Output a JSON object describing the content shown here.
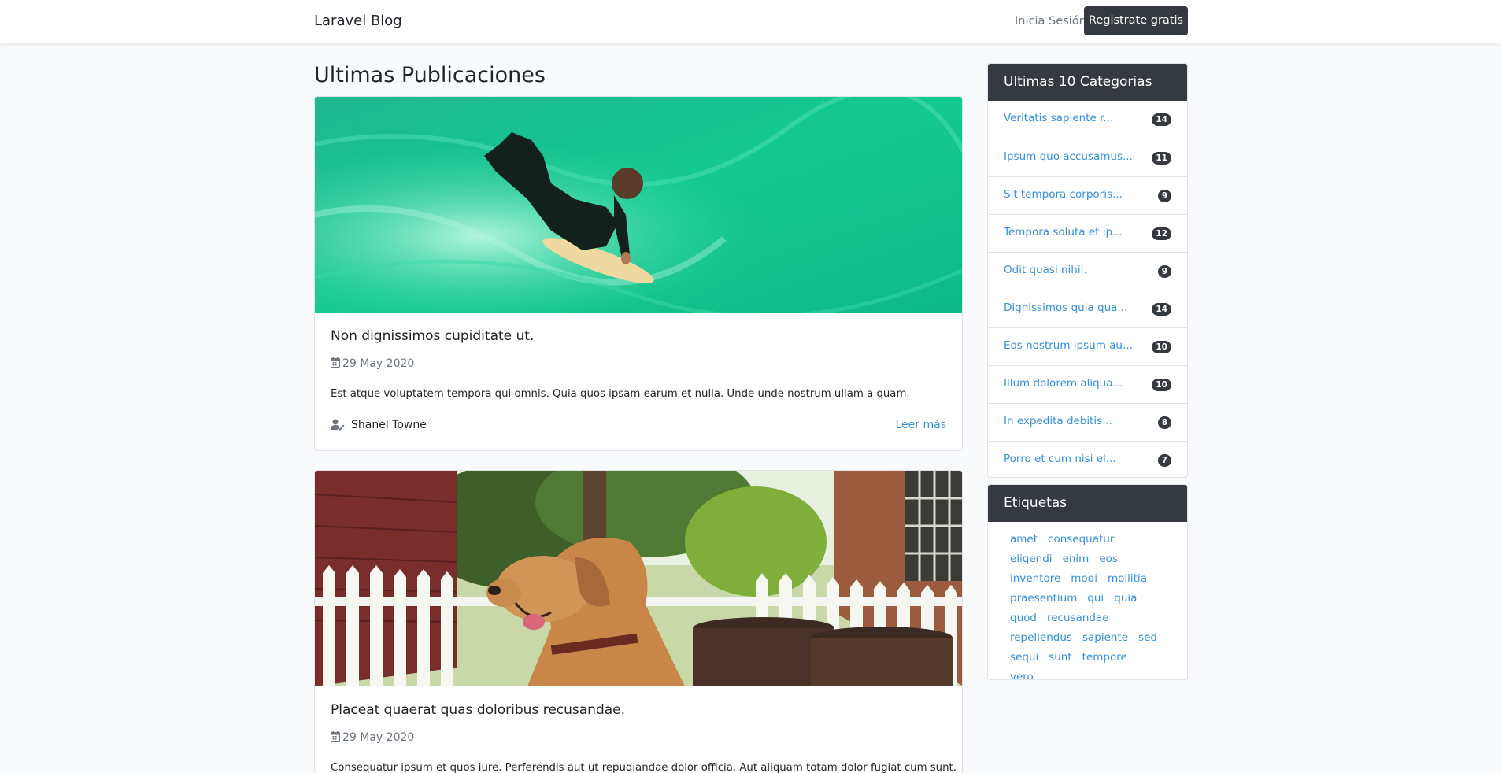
{
  "navbar": {
    "brand": "Laravel Blog",
    "login": "Inicia Sesión",
    "register": "Registrate gratis"
  },
  "main": {
    "title": "Ultimas Publicaciones",
    "posts": [
      {
        "title": "Non dignissimos cupiditate ut.",
        "date": "29 May 2020",
        "excerpt": "Est atque voluptatem tempora qui omnis. Quia quos ipsam earum et nulla. Unde unde nostrum ullam a quam.",
        "author": "Shanel Towne",
        "more": "Leer más",
        "image": "surfer-bodyboarding-photo"
      },
      {
        "title": "Placeat quaerat quas doloribus recusandae.",
        "date": "29 May 2020",
        "excerpt": "Consequatur ipsum et quos iure. Perferendis aut ut repudiandae dolor officia. Aut aliquam totam dolor fugiat cum sunt.",
        "image": "dog-fence-photo"
      }
    ]
  },
  "sidebar": {
    "categories_title": "Ultimas 10 Categorias",
    "categories": [
      {
        "name": "Veritatis sapiente r...",
        "count": "14"
      },
      {
        "name": "Ipsum quo accusamus...",
        "count": "11"
      },
      {
        "name": "Sit tempora corporis...",
        "count": "9"
      },
      {
        "name": "Tempora soluta et ip...",
        "count": "12"
      },
      {
        "name": "Odit quasi nihil.",
        "count": "9"
      },
      {
        "name": "Dignissimos quia qua...",
        "count": "14"
      },
      {
        "name": "Eos nostrum ipsum au...",
        "count": "10"
      },
      {
        "name": "Illum dolorem aliqua...",
        "count": "10"
      },
      {
        "name": "In expedita debitis...",
        "count": "8"
      },
      {
        "name": "Porro et cum nisi el...",
        "count": "7"
      }
    ],
    "tags_title": "Etiquetas",
    "tags": [
      "amet",
      "consequatur",
      "eligendi",
      "enim",
      "eos",
      "inventore",
      "modi",
      "mollitia",
      "praesentium",
      "qui",
      "quia",
      "quod",
      "recusandae",
      "repellendus",
      "sapiente",
      "sed",
      "sequi",
      "sunt",
      "tempore",
      "vero"
    ]
  },
  "colors": {
    "navbar_bg": "#ffffff",
    "page_bg": "#f8fafc",
    "dark": "#343a40",
    "link": "#3490dc",
    "muted": "#6c757d"
  }
}
